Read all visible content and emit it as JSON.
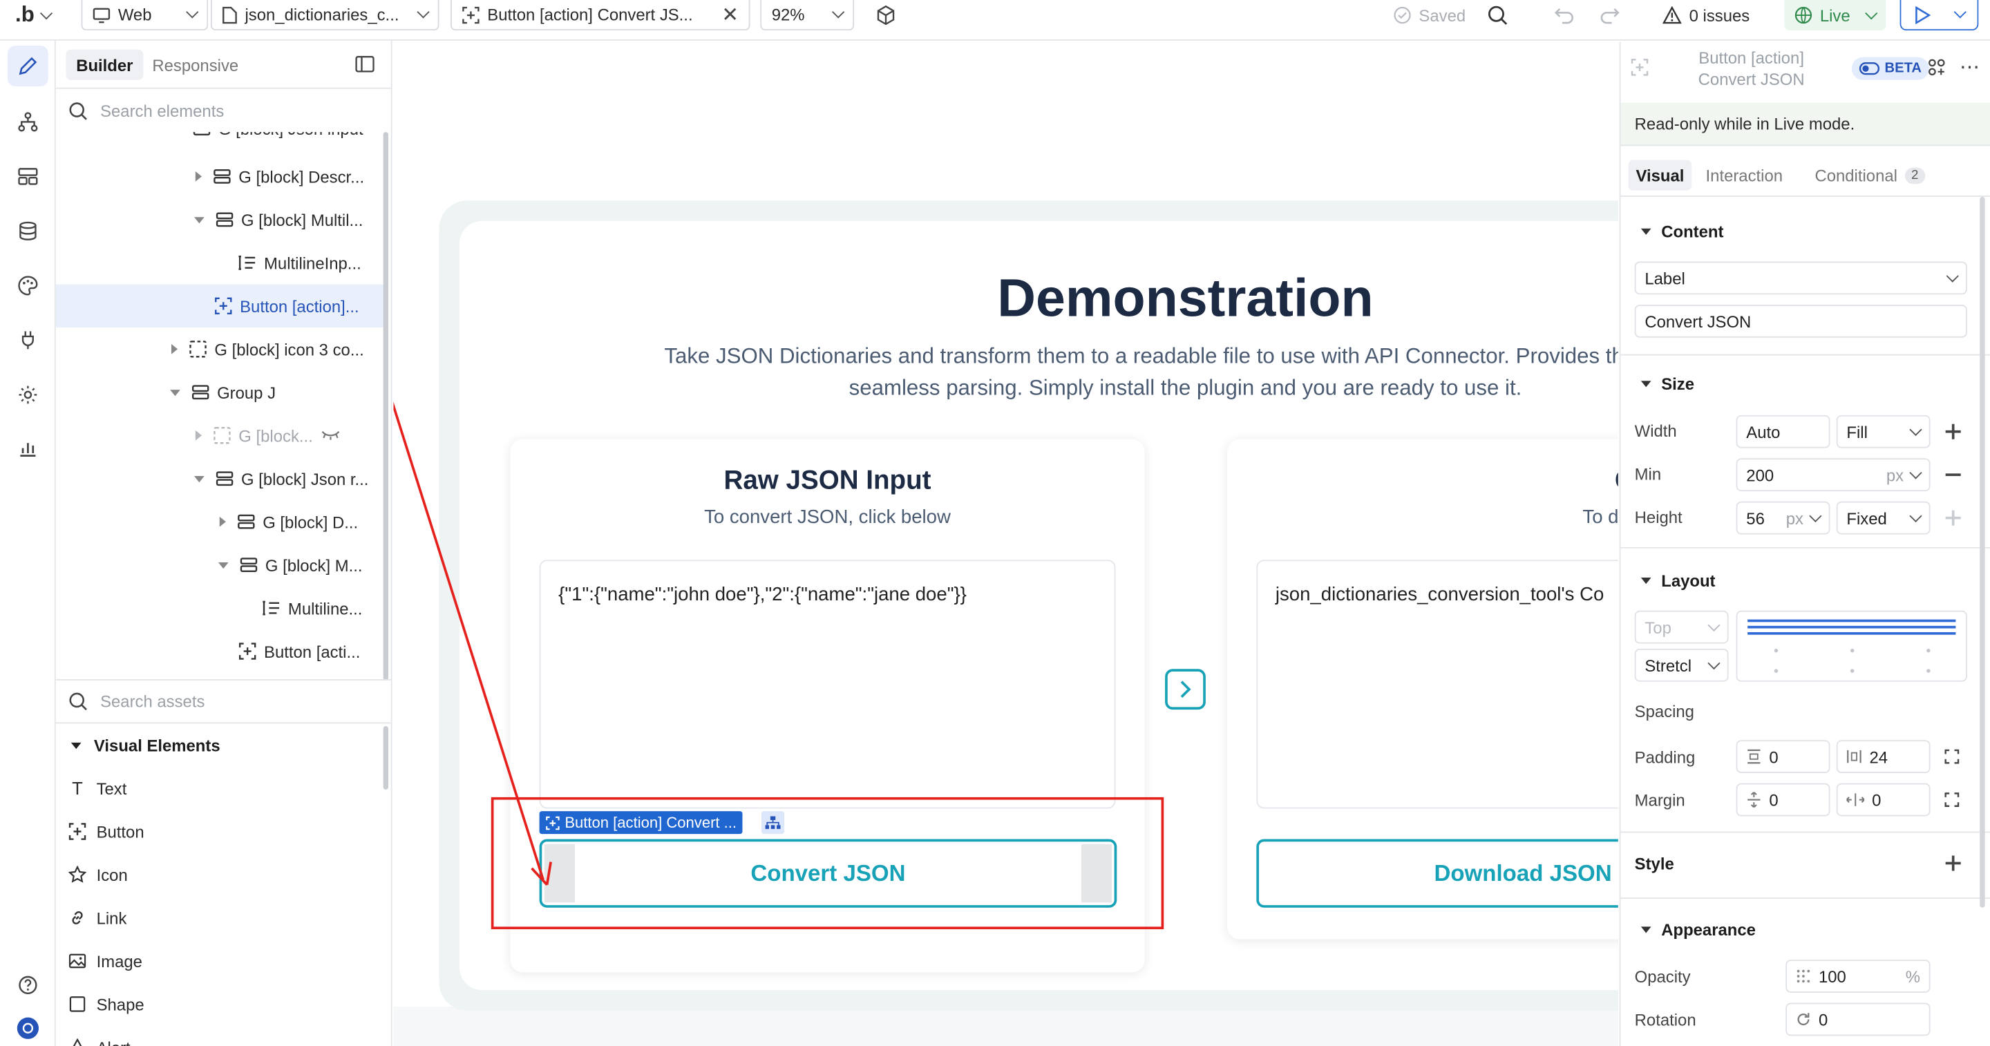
{
  "topbar": {
    "platform": "Web",
    "page_name": "json_dictionaries_c...",
    "element_tab": "Button [action] Convert JS...",
    "zoom": "92%",
    "saved": "Saved",
    "issues": "0 issues",
    "live": "Live"
  },
  "left_panel": {
    "tab_builder": "Builder",
    "tab_responsive": "Responsive",
    "search_elements_placeholder": "Search elements",
    "tree": [
      {
        "label": "G [block] Json input"
      },
      {
        "label": "G [block] Descr..."
      },
      {
        "label": "G [block] Multil..."
      },
      {
        "label": "MultilineInp..."
      },
      {
        "label": "Button [action]..."
      },
      {
        "label": "G [block] icon 3 co..."
      },
      {
        "label": "Group J"
      },
      {
        "label": "G [block..."
      },
      {
        "label": "G [block] Json r..."
      },
      {
        "label": "G [block] D..."
      },
      {
        "label": "G [block] M..."
      },
      {
        "label": "Multiline..."
      },
      {
        "label": "Button [acti..."
      }
    ],
    "search_assets_placeholder": "Search assets",
    "visual_elements_heading": "Visual Elements",
    "assets": [
      "Text",
      "Button",
      "Icon",
      "Link",
      "Image",
      "Shape",
      "Alert"
    ]
  },
  "canvas": {
    "title": "Demonstration",
    "subtitle_line1": "Take JSON Dictionaries and transform them to a readable file to use with API Connector. Provides the structu",
    "subtitle_line2": "seamless parsing. Simply install the plugin and you are ready to use it.",
    "left_card": {
      "title": "Raw JSON Input",
      "subtitle": "To convert JSON, click below",
      "input_value": "{\"1\":{\"name\":\"john doe\"},\"2\":{\"name\":\"jane doe\"}}",
      "button_label": "Convert JSON"
    },
    "right_card": {
      "title": "Converted JS",
      "subtitle": "To download the result, c",
      "output_value": "json_dictionaries_conversion_tool's Co",
      "button_label": "Download JSON"
    },
    "selection_label": "Button [action] Convert ..."
  },
  "props": {
    "title": "Button [action] Convert JSON",
    "beta": "BETA",
    "readonly_notice": "Read-only while in Live mode.",
    "tabs": {
      "visual": "Visual",
      "interaction": "Interaction",
      "conditional": "Conditional",
      "conditional_count": "2"
    },
    "content": {
      "heading": "Content",
      "type_select": "Label",
      "label_value": "Convert JSON"
    },
    "size": {
      "heading": "Size",
      "width_label": "Width",
      "width_value": "Auto",
      "width_mode": "Fill",
      "min_label": "Min",
      "min_value": "200",
      "min_unit": "px",
      "height_label": "Height",
      "height_value": "56",
      "height_unit": "px",
      "height_mode": "Fixed"
    },
    "layout": {
      "heading": "Layout",
      "align_select": "Top",
      "stretch_select": "Stretcl",
      "spacing_label": "Spacing",
      "padding_label": "Padding",
      "padding_vertical": "0",
      "padding_horizontal": "24",
      "margin_label": "Margin",
      "margin_vertical": "0",
      "margin_horizontal": "0"
    },
    "style": {
      "heading": "Style"
    },
    "appearance": {
      "heading": "Appearance",
      "opacity_label": "Opacity",
      "opacity_value": "100",
      "opacity_unit": "%",
      "rotation_label": "Rotation",
      "rotation_value": "0"
    }
  },
  "colors": {
    "accent_teal": "#17a2b8",
    "selection_blue": "#1f66d1",
    "annotation_red": "#e5211d",
    "live_green": "#2f8a4b"
  }
}
